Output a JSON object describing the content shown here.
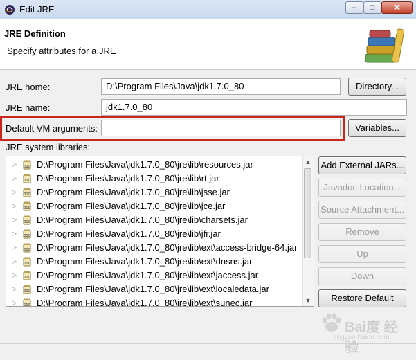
{
  "window": {
    "title": "Edit JRE",
    "min_label": "–",
    "max_label": "□",
    "close_label": "✕"
  },
  "header": {
    "title": "JRE Definition",
    "subtitle": "Specify attributes for a JRE"
  },
  "form": {
    "jre_home_label": "JRE home:",
    "jre_home_value": "D:\\Program Files\\Java\\jdk1.7.0_80",
    "directory_button": "Directory...",
    "jre_name_label": "JRE name:",
    "jre_name_value": "jdk1.7.0_80",
    "vm_args_label": "Default VM arguments:",
    "vm_args_value": "",
    "variables_button": "Variables...",
    "libraries_label": "JRE system libraries:"
  },
  "libraries": [
    "D:\\Program Files\\Java\\jdk1.7.0_80\\jre\\lib\\resources.jar",
    "D:\\Program Files\\Java\\jdk1.7.0_80\\jre\\lib\\rt.jar",
    "D:\\Program Files\\Java\\jdk1.7.0_80\\jre\\lib\\jsse.jar",
    "D:\\Program Files\\Java\\jdk1.7.0_80\\jre\\lib\\jce.jar",
    "D:\\Program Files\\Java\\jdk1.7.0_80\\jre\\lib\\charsets.jar",
    "D:\\Program Files\\Java\\jdk1.7.0_80\\jre\\lib\\jfr.jar",
    "D:\\Program Files\\Java\\jdk1.7.0_80\\jre\\lib\\ext\\access-bridge-64.jar",
    "D:\\Program Files\\Java\\jdk1.7.0_80\\jre\\lib\\ext\\dnsns.jar",
    "D:\\Program Files\\Java\\jdk1.7.0_80\\jre\\lib\\ext\\jaccess.jar",
    "D:\\Program Files\\Java\\jdk1.7.0_80\\jre\\lib\\ext\\localedata.jar",
    "D:\\Program Files\\Java\\jdk1.7.0_80\\jre\\lib\\ext\\sunec.jar"
  ],
  "library_buttons": {
    "add_external": "Add External JARs...",
    "javadoc": "Javadoc Location...",
    "source": "Source Attachment...",
    "remove": "Remove",
    "up": "Up",
    "down": "Down",
    "restore": "Restore Default"
  },
  "watermark": {
    "text": "Bai度 经验",
    "sub": "jingyan.baidu.com"
  },
  "colors": {
    "highlight": "#c8261c",
    "close_button": "#c6402a"
  },
  "icons": {
    "app": "eclipse-icon",
    "header": "books-icon",
    "jar": "jar-icon",
    "expand": "chevron-right-icon"
  }
}
